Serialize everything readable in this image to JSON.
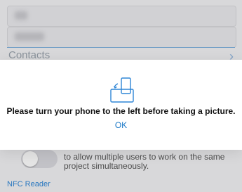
{
  "background": {
    "contacts_label": "Contacts",
    "toggle": {
      "state": "off"
    },
    "description": "to allow multiple users to work on the same project simultaneously.",
    "nfc_reader": "NFC Reader"
  },
  "dialog": {
    "icon": "rotate-phone-left-icon",
    "message": "Please turn your phone to the left before taking a picture.",
    "ok_label": "OK"
  },
  "colors": {
    "accent": "#1a78c7",
    "icon": "#2f86d6"
  }
}
